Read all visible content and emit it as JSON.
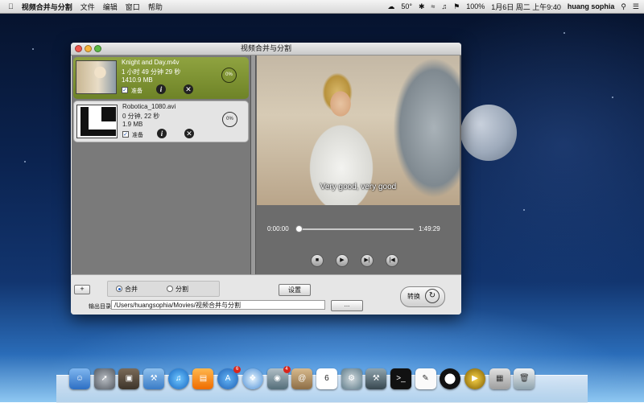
{
  "menubar": {
    "apple_icon": "apple-icon",
    "app_name": "视频合并与分割",
    "menus": [
      "文件",
      "编辑",
      "窗口",
      "帮助"
    ],
    "weather": "50°",
    "battery": "100%",
    "datetime": "1月6日 周二 上午9:40",
    "user": "huang sophia"
  },
  "window": {
    "title": "视频合并与分割",
    "items": [
      {
        "name": "Knight and Day.m4v",
        "duration": "1 小时 49 分钟 29 秒",
        "size": "1410.9 MB",
        "ready_label": "准备",
        "progress": "0%",
        "selected": true
      },
      {
        "name": "Robotica_1080.avi",
        "duration": "0 分钟, 22 秒",
        "size": "1.9 MB",
        "ready_label": "准备",
        "progress": "0%",
        "selected": false
      }
    ],
    "player": {
      "subtitle": "Very good, very good",
      "current_time": "0:00:00",
      "total_time": "1:49:29",
      "playback_fraction": 0.0
    },
    "bottom": {
      "add_label": "+",
      "mode_merge": "合并",
      "mode_split": "分割",
      "selected_mode": "merge",
      "settings_label": "设置",
      "convert_label": "转换",
      "output_label": "输出目录:",
      "output_path": "/Users/huangsophia/Movies/视频合并与分割",
      "browse_label": "..."
    }
  },
  "dock": {
    "icons": [
      "finder-icon",
      "launchpad-icon",
      "photo-icon",
      "xcode-icon",
      "itunes-icon",
      "ibooks-icon",
      "app-store-icon",
      "safari-icon",
      "facetime-icon",
      "contacts-icon",
      "calendar-icon",
      "system-preferences-icon",
      "xcode-tools-icon",
      "terminal-icon",
      "textedit-icon",
      "qq-icon",
      "video-app-icon",
      "applications-folder-icon",
      "trash-icon"
    ],
    "badges": {
      "app_store": "6",
      "facetime": "4"
    },
    "calendar_day": "6"
  },
  "colors": {
    "selected_item": "#7d922f",
    "list_bg": "#7a7a7a",
    "player_bg": "#6c6c6c",
    "accent_radio": "#1f5fc9"
  }
}
